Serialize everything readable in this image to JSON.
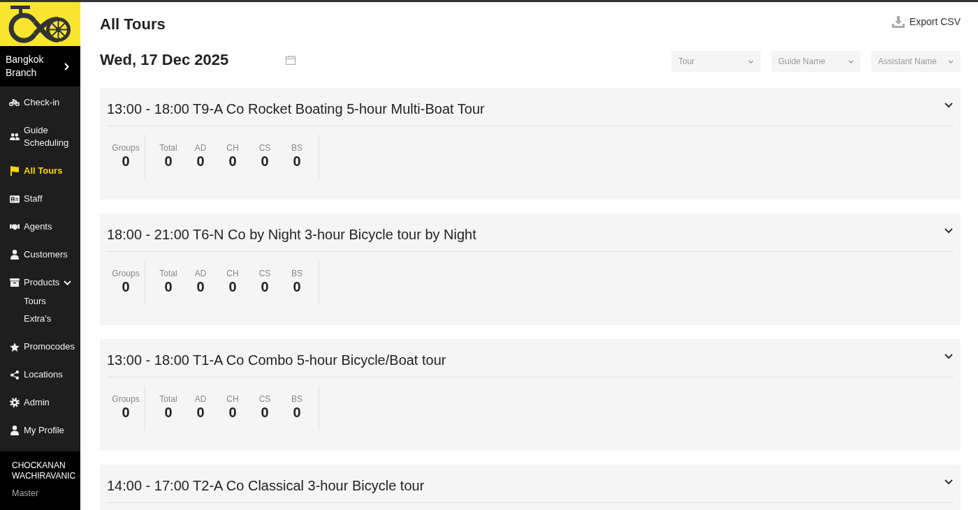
{
  "sidebar": {
    "branch": "Bangkok Branch",
    "items": [
      {
        "label": "Check-in",
        "selected": false
      },
      {
        "label": "Guide Scheduling",
        "selected": false
      },
      {
        "label": "All Tours",
        "selected": true
      },
      {
        "label": "Staff",
        "selected": false
      },
      {
        "label": "Agents",
        "selected": false
      },
      {
        "label": "Customers",
        "selected": false
      },
      {
        "label": "Products",
        "selected": false,
        "expanded": true,
        "children": [
          {
            "label": "Tours",
            "selected": false
          },
          {
            "label": "Extra's",
            "selected": false
          }
        ]
      },
      {
        "label": "Promocodes",
        "selected": false
      },
      {
        "label": "Locations",
        "selected": false
      },
      {
        "label": "Admin",
        "selected": false
      },
      {
        "label": "My Profile",
        "selected": false
      }
    ],
    "user": {
      "name": "CHOCKANAN WACHIRAVANIC",
      "role": "Master"
    }
  },
  "header": {
    "title": "All Tours",
    "export_button": "Export CSV",
    "date": "Wed, 17 Dec 2025",
    "filters": [
      {
        "placeholder": "Tour"
      },
      {
        "placeholder": "Guide Name"
      },
      {
        "placeholder": "Assistant Name"
      }
    ]
  },
  "tours": [
    {
      "title": "13:00 - 18:00 T9-A Co Rocket Boating 5-hour Multi-Boat Tour",
      "groups": {
        "label": "Groups",
        "value": "0"
      },
      "counts": [
        {
          "label": "Total",
          "value": "0"
        },
        {
          "label": "AD",
          "value": "0"
        },
        {
          "label": "CH",
          "value": "0"
        },
        {
          "label": "CS",
          "value": "0"
        },
        {
          "label": "BS",
          "value": "0"
        }
      ]
    },
    {
      "title": "18:00 - 21:00 T6-N Co by Night 3-hour Bicycle tour by Night",
      "groups": {
        "label": "Groups",
        "value": "0"
      },
      "counts": [
        {
          "label": "Total",
          "value": "0"
        },
        {
          "label": "AD",
          "value": "0"
        },
        {
          "label": "CH",
          "value": "0"
        },
        {
          "label": "CS",
          "value": "0"
        },
        {
          "label": "BS",
          "value": "0"
        }
      ]
    },
    {
      "title": "13:00 - 18:00 T1-A Co Combo 5-hour Bicycle/Boat tour",
      "groups": {
        "label": "Groups",
        "value": "0"
      },
      "counts": [
        {
          "label": "Total",
          "value": "0"
        },
        {
          "label": "AD",
          "value": "0"
        },
        {
          "label": "CH",
          "value": "0"
        },
        {
          "label": "CS",
          "value": "0"
        },
        {
          "label": "BS",
          "value": "0"
        }
      ]
    },
    {
      "title": "14:00 - 17:00 T2-A Co Classical 3-hour Bicycle tour"
    }
  ]
}
